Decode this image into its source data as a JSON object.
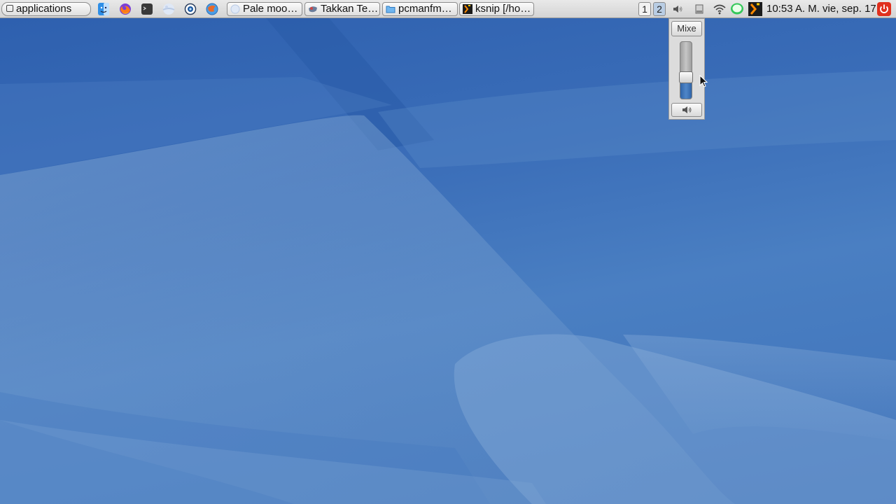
{
  "panel": {
    "app_menu_label": "applications",
    "launchers": [
      {
        "icon": "finder-face-icon"
      },
      {
        "icon": "firefox-icon"
      },
      {
        "icon": "terminal-icon"
      },
      {
        "icon": "pale-moon-icon"
      },
      {
        "icon": "camera-icon"
      },
      {
        "icon": "takkan-globe-icon"
      }
    ],
    "tasks": [
      {
        "label": "Pale moo…",
        "icon": "pale-moon-icon"
      },
      {
        "label": "Takkan Te…",
        "icon": "takkan-icon"
      },
      {
        "label": "pcmanfm…",
        "icon": "folder-icon"
      },
      {
        "label": "ksnip [/ho…",
        "icon": "ksnip-icon"
      }
    ],
    "workspaces": [
      "1",
      "2"
    ],
    "active_workspace": "2",
    "tray_icons": [
      "volume-icon",
      "drive-icon",
      "wifi-icon",
      "chat-bubble-icon",
      "ksnip-tray-icon"
    ],
    "clock": "10:53 A. M. vie, sep. 17",
    "power_icon": "power-icon"
  },
  "volume_popup": {
    "mixer_label": "Mixe",
    "level": 0.32,
    "mute_icon": "speaker-icon"
  },
  "colors": {
    "panel_bg": "#dedede",
    "desktop_bg": "#3d6fb3",
    "volume_fill": "#3f77bd",
    "power_red": "#e0301e"
  }
}
